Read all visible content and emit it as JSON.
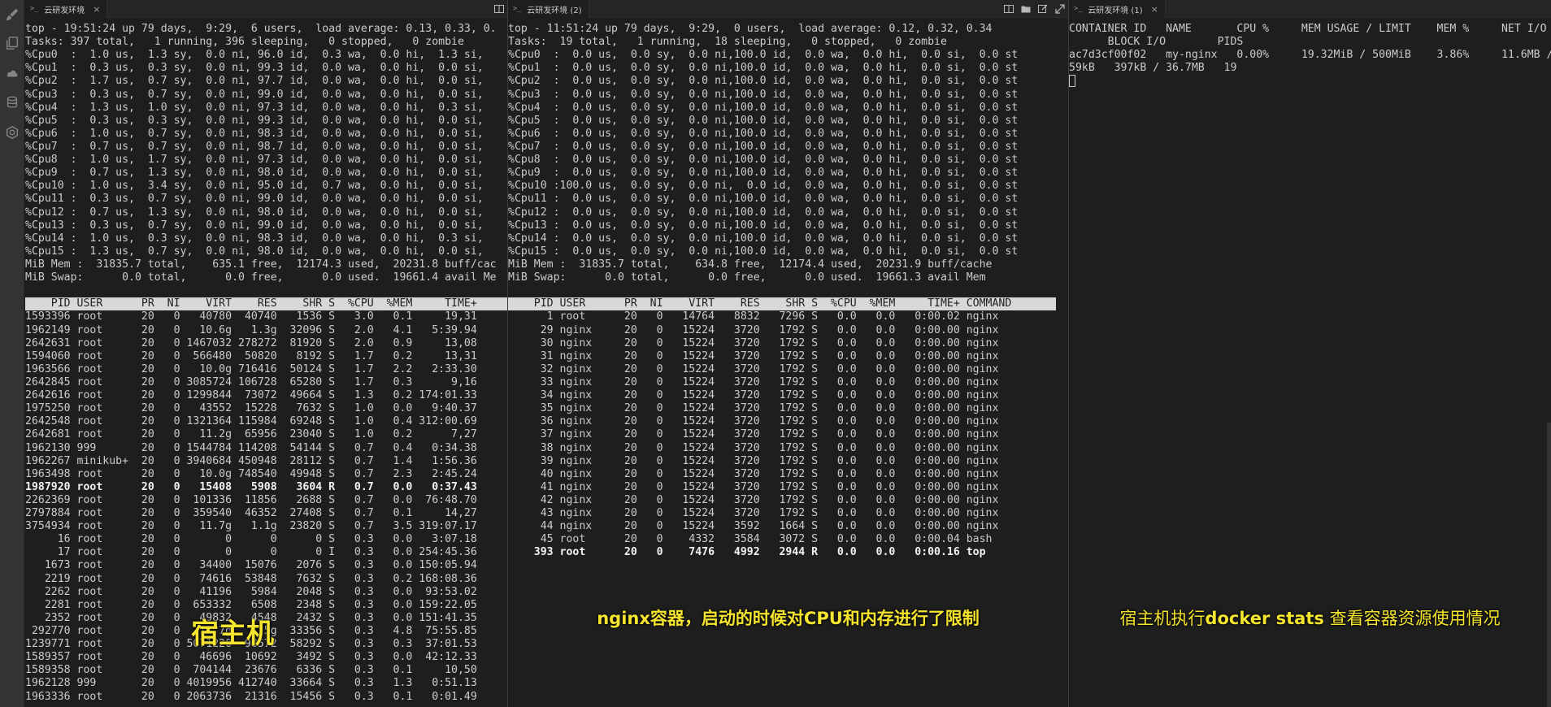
{
  "tabs": {
    "host": {
      "icon": ">_",
      "title": "云研发环境",
      "close": "×"
    },
    "nginx": {
      "icon": ">_",
      "title": "云研发环境 (2)"
    },
    "stats": {
      "icon": ">_",
      "title": "云研发环境 (1)",
      "close": "×"
    }
  },
  "host": {
    "lines": [
      "top - 19:51:24 up 79 days,  9:29,  6 users,  load average: 0.13, 0.33, 0.",
      "Tasks: 397 total,   1 running, 396 sleeping,   0 stopped,   0 zombie",
      "%Cpu0  :  1.0 us,  1.3 sy,  0.0 ni, 96.0 id,  0.3 wa,  0.0 hi,  1.3 si,",
      "%Cpu1  :  0.3 us,  0.3 sy,  0.0 ni, 99.3 id,  0.0 wa,  0.0 hi,  0.0 si,",
      "%Cpu2  :  1.7 us,  0.7 sy,  0.0 ni, 97.7 id,  0.0 wa,  0.0 hi,  0.0 si,",
      "%Cpu3  :  0.3 us,  0.7 sy,  0.0 ni, 99.0 id,  0.0 wa,  0.0 hi,  0.0 si,",
      "%Cpu4  :  1.3 us,  1.0 sy,  0.0 ni, 97.3 id,  0.0 wa,  0.0 hi,  0.3 si,",
      "%Cpu5  :  0.3 us,  0.3 sy,  0.0 ni, 99.3 id,  0.0 wa,  0.0 hi,  0.0 si,",
      "%Cpu6  :  1.0 us,  0.7 sy,  0.0 ni, 98.3 id,  0.0 wa,  0.0 hi,  0.0 si,",
      "%Cpu7  :  0.7 us,  0.7 sy,  0.0 ni, 98.7 id,  0.0 wa,  0.0 hi,  0.0 si,",
      "%Cpu8  :  1.0 us,  1.7 sy,  0.0 ni, 97.3 id,  0.0 wa,  0.0 hi,  0.0 si,",
      "%Cpu9  :  0.7 us,  1.3 sy,  0.0 ni, 98.0 id,  0.0 wa,  0.0 hi,  0.0 si,",
      "%Cpu10 :  1.0 us,  3.4 sy,  0.0 ni, 95.0 id,  0.7 wa,  0.0 hi,  0.0 si,",
      "%Cpu11 :  0.3 us,  0.7 sy,  0.0 ni, 99.0 id,  0.0 wa,  0.0 hi,  0.0 si,",
      "%Cpu12 :  0.7 us,  1.3 sy,  0.0 ni, 98.0 id,  0.0 wa,  0.0 hi,  0.0 si,",
      "%Cpu13 :  0.3 us,  0.7 sy,  0.0 ni, 99.0 id,  0.0 wa,  0.0 hi,  0.0 si,",
      "%Cpu14 :  1.0 us,  0.3 sy,  0.0 ni, 98.3 id,  0.0 wa,  0.0 hi,  0.3 si,",
      "%Cpu15 :  1.3 us,  0.7 sy,  0.0 ni, 98.0 id,  0.0 wa,  0.0 hi,  0.0 si,",
      "MiB Mem :  31835.7 total,    635.1 free,  12174.3 used,  20231.8 buff/cac",
      "MiB Swap:      0.0 total,      0.0 free,      0.0 used.  19661.4 avail Me"
    ],
    "header": "    PID USER      PR  NI    VIRT    RES    SHR S  %CPU  %MEM     TIME+ ",
    "rows": [
      "1593396 root      20   0   40780  40740   1536 S   3.0   0.1     19,31",
      "1962149 root      20   0   10.6g   1.3g  32096 S   2.0   4.1   5:39.94",
      "2642631 root      20   0 1467032 278272  81920 S   2.0   0.9     13,08",
      "1594060 root      20   0  566480  50820   8192 S   1.7   0.2     13,31",
      "1963566 root      20   0   10.0g 716416  50124 S   1.7   2.2   2:33.30",
      "2642845 root      20   0 3085724 106728  65280 S   1.7   0.3      9,16",
      "2642616 root      20   0 1299844  73072  49664 S   1.3   0.2 174:01.33",
      "1975250 root      20   0   43552  15228   7632 S   1.0   0.0   9:40.37",
      "2642548 root      20   0 1321364 115984  69248 S   1.0   0.4 312:00.69",
      "2642681 root      20   0   11.2g  65956  23040 S   1.0   0.2      7,27",
      "1962130 999       20   0 1544784 114208  54144 S   0.7   0.4   0:34.38",
      "1962267 minikub+  20   0 3940684 450948  28112 S   0.7   1.4   1:56.36",
      "1963498 root      20   0   10.0g 748540  49948 S   0.7   2.3   2:45.24",
      "1987920 root      20   0   15408   5908   3604 R   0.7   0.0   0:37.43",
      "2262369 root      20   0  101336  11856   2688 S   0.7   0.0  76:48.70",
      "2797884 root      20   0  359540  46352  27408 S   0.7   0.1     14,27",
      "3754934 root      20   0   11.7g   1.1g  23820 S   0.7   3.5 319:07.17",
      "     16 root      20   0       0      0      0 S   0.3   0.0   3:07.18",
      "     17 root      20   0       0      0      0 I   0.3   0.0 254:45.36",
      "   1673 root      20   0   34400  15076   2076 S   0.3   0.0 150:05.94",
      "   2219 root      20   0   74616  53848   7632 S   0.3   0.2 168:08.36",
      "   2262 root      20   0   41196   5984   2048 S   0.3   0.0  93:53.02",
      "   2281 root      20   0  653332   6508   2348 S   0.3   0.0 159:22.05",
      "   2352 root      20   0   49832   4548   2432 S   0.3   0.0 151:41.35",
      " 292770 root      20   0   12.7g   1.5g  33356 S   0.3   4.8  75:55.85",
      "1239771 root      20   0 5071220  98572  58292 S   0.3   0.3  37:01.53",
      "1589357 root      20   0   46696  10692   3492 S   0.3   0.0  42:12.33",
      "1589358 root      20   0  704144  23676   6336 S   0.3   0.1     10,50",
      "1962128 999       20   0 4019956 412740  33664 S   0.3   1.3   0:51.13",
      "1963336 root      20   0 2063736  21316  15456 S   0.3   0.1   0:01.49"
    ],
    "bold_row": 13,
    "caption": "宿主机"
  },
  "nginx": {
    "lines": [
      "top - 11:51:24 up 79 days,  9:29,  0 users,  load average: 0.12, 0.32, 0.34",
      "Tasks:  19 total,   1 running,  18 sleeping,   0 stopped,   0 zombie",
      "%Cpu0  :  0.0 us,  0.0 sy,  0.0 ni,100.0 id,  0.0 wa,  0.0 hi,  0.0 si,  0.0 st",
      "%Cpu1  :  0.0 us,  0.0 sy,  0.0 ni,100.0 id,  0.0 wa,  0.0 hi,  0.0 si,  0.0 st",
      "%Cpu2  :  0.0 us,  0.0 sy,  0.0 ni,100.0 id,  0.0 wa,  0.0 hi,  0.0 si,  0.0 st",
      "%Cpu3  :  0.0 us,  0.0 sy,  0.0 ni,100.0 id,  0.0 wa,  0.0 hi,  0.0 si,  0.0 st",
      "%Cpu4  :  0.0 us,  0.0 sy,  0.0 ni,100.0 id,  0.0 wa,  0.0 hi,  0.0 si,  0.0 st",
      "%Cpu5  :  0.0 us,  0.0 sy,  0.0 ni,100.0 id,  0.0 wa,  0.0 hi,  0.0 si,  0.0 st",
      "%Cpu6  :  0.0 us,  0.0 sy,  0.0 ni,100.0 id,  0.0 wa,  0.0 hi,  0.0 si,  0.0 st",
      "%Cpu7  :  0.0 us,  0.0 sy,  0.0 ni,100.0 id,  0.0 wa,  0.0 hi,  0.0 si,  0.0 st",
      "%Cpu8  :  0.0 us,  0.0 sy,  0.0 ni,100.0 id,  0.0 wa,  0.0 hi,  0.0 si,  0.0 st",
      "%Cpu9  :  0.0 us,  0.0 sy,  0.0 ni,100.0 id,  0.0 wa,  0.0 hi,  0.0 si,  0.0 st",
      "%Cpu10 :100.0 us,  0.0 sy,  0.0 ni,  0.0 id,  0.0 wa,  0.0 hi,  0.0 si,  0.0 st",
      "%Cpu11 :  0.0 us,  0.0 sy,  0.0 ni,100.0 id,  0.0 wa,  0.0 hi,  0.0 si,  0.0 st",
      "%Cpu12 :  0.0 us,  0.0 sy,  0.0 ni,100.0 id,  0.0 wa,  0.0 hi,  0.0 si,  0.0 st",
      "%Cpu13 :  0.0 us,  0.0 sy,  0.0 ni,100.0 id,  0.0 wa,  0.0 hi,  0.0 si,  0.0 st",
      "%Cpu14 :  0.0 us,  0.0 sy,  0.0 ni,100.0 id,  0.0 wa,  0.0 hi,  0.0 si,  0.0 st",
      "%Cpu15 :  0.0 us,  0.0 sy,  0.0 ni,100.0 id,  0.0 wa,  0.0 hi,  0.0 si,  0.0 st",
      "MiB Mem :  31835.7 total,    634.8 free,  12174.4 used,  20231.9 buff/cache",
      "MiB Swap:      0.0 total,      0.0 free,      0.0 used.  19661.3 avail Mem"
    ],
    "header": "    PID USER      PR  NI    VIRT    RES    SHR S  %CPU  %MEM     TIME+ COMMAND     ",
    "rows": [
      "      1 root      20   0   14764   8832   7296 S   0.0   0.0   0:00.02 nginx",
      "     29 nginx     20   0   15224   3720   1792 S   0.0   0.0   0:00.00 nginx",
      "     30 nginx     20   0   15224   3720   1792 S   0.0   0.0   0:00.00 nginx",
      "     31 nginx     20   0   15224   3720   1792 S   0.0   0.0   0:00.00 nginx",
      "     32 nginx     20   0   15224   3720   1792 S   0.0   0.0   0:00.00 nginx",
      "     33 nginx     20   0   15224   3720   1792 S   0.0   0.0   0:00.00 nginx",
      "     34 nginx     20   0   15224   3720   1792 S   0.0   0.0   0:00.00 nginx",
      "     35 nginx     20   0   15224   3720   1792 S   0.0   0.0   0:00.00 nginx",
      "     36 nginx     20   0   15224   3720   1792 S   0.0   0.0   0:00.00 nginx",
      "     37 nginx     20   0   15224   3720   1792 S   0.0   0.0   0:00.00 nginx",
      "     38 nginx     20   0   15224   3720   1792 S   0.0   0.0   0:00.00 nginx",
      "     39 nginx     20   0   15224   3720   1792 S   0.0   0.0   0:00.00 nginx",
      "     40 nginx     20   0   15224   3720   1792 S   0.0   0.0   0:00.00 nginx",
      "     41 nginx     20   0   15224   3720   1792 S   0.0   0.0   0:00.00 nginx",
      "     42 nginx     20   0   15224   3720   1792 S   0.0   0.0   0:00.00 nginx",
      "     43 nginx     20   0   15224   3720   1792 S   0.0   0.0   0:00.00 nginx",
      "     44 nginx     20   0   15224   3592   1664 S   0.0   0.0   0:00.00 nginx",
      "     45 root      20   0    4332   3584   3072 S   0.0   0.0   0:00.04 bash",
      "    393 root      20   0    7476   4992   2944 R   0.0   0.0   0:00.16 top"
    ],
    "bold_row": 18,
    "caption": "nginx容器，启动的时候对CPU和内存进行了限制"
  },
  "stats": {
    "lines": [
      "CONTAINER ID   NAME       CPU %     MEM USAGE / LIMIT    MEM %     NET I/O",
      "      BLOCK I/O        PIDS",
      "ac7d3cf00f02   my-nginx   0.00%     19.32MiB / 500MiB    3.86%     11.6MB /",
      "59kB   397kB / 36.7MB   19"
    ],
    "caption_pre": "宿主机执行",
    "caption_bold": "docker stats",
    "caption_post": " 查看容器资源使用情况"
  }
}
